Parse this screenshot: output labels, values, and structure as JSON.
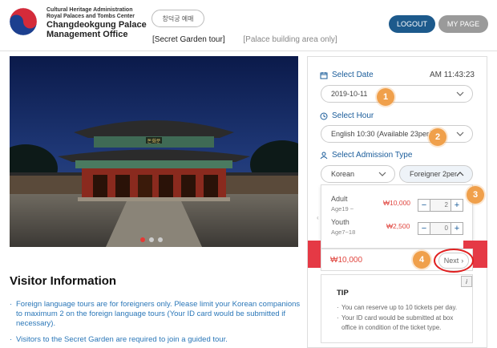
{
  "header": {
    "org_line1": "Cultural Heritage Administration",
    "org_line2": "Royal Palaces and Tombs Center",
    "org_line3": "Changdeokgung Palace",
    "org_line4": "Management Office",
    "lang_button": "창덕궁 예매",
    "tab_secret_garden": "[Secret Garden tour]",
    "tab_palace_building": "[Palace building area only]",
    "logout_label": "LOGOUT",
    "mypage_label": "MY PAGE",
    "logo_icon": "taegeuk-logo-icon"
  },
  "hero": {
    "gate_sign": "돈화문",
    "slides_total": 3,
    "active_slide": 1
  },
  "visitor_info": {
    "title": "Visitor Information",
    "items": [
      "Foreign language tours are for foreigners only. Please limit your Korean companions to maximum 2 on the foreign language tours (Your ID card would be submitted if necessary).",
      "Visitors to the Secret Garden are required to join a guided tour."
    ]
  },
  "booking": {
    "select_date_label": "Select Date",
    "time": "AM 11:43:23",
    "date_value": "2019-10-11",
    "select_hour_label": "Select Hour",
    "hour_value": "English 10:30 (Available 23per.)",
    "admission_label": "Select Admission Type",
    "type_korean": "Korean",
    "type_foreigner": "Foreigner 2per.",
    "tickets": [
      {
        "name": "Adult",
        "age": "Age19 ~",
        "price": "₩10,000",
        "qty": "2"
      },
      {
        "name": "Youth",
        "age": "Age7~18",
        "price": "₩2,500",
        "qty": "0"
      }
    ],
    "total": "₩10,000",
    "next_label": "Next",
    "tip_title": "TIP",
    "tip_items": [
      "You can reserve up to 10 tickets per day.",
      "Your ID card would be submitted at box office in condition of the ticket type."
    ],
    "info_icon_label": "i"
  },
  "badges": [
    "1",
    "2",
    "3",
    "4"
  ],
  "colors": {
    "accent_blue": "#1d5a8c",
    "badge_orange": "#f0a04b",
    "price_red": "#e0463f",
    "highlight_ring": "#e02020",
    "info_text_blue": "#2b77b8"
  }
}
